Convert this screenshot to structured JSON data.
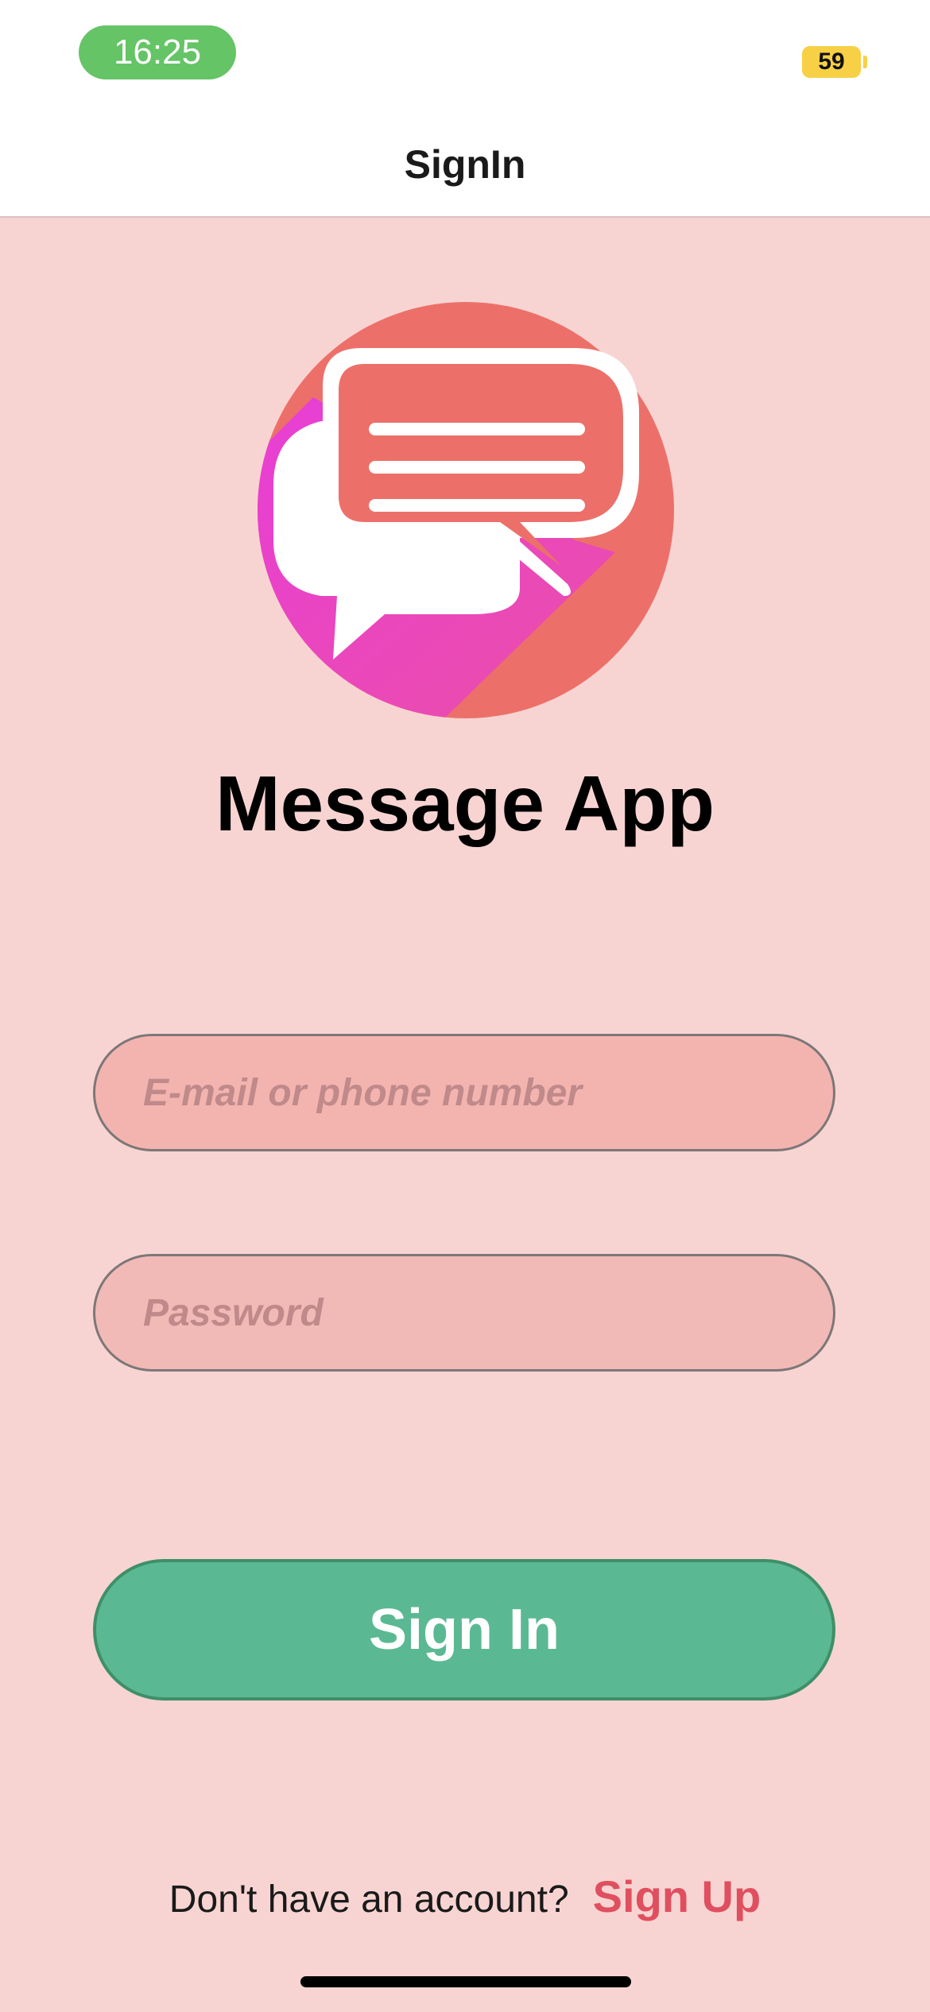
{
  "status_bar": {
    "time": "16:25",
    "battery": "59"
  },
  "nav": {
    "title": "SignIn"
  },
  "app": {
    "name": "Message App",
    "logo_icon": "chat-bubbles-icon"
  },
  "form": {
    "email_placeholder": "E-mail or phone number",
    "password_placeholder": "Password",
    "signin_label": "Sign In"
  },
  "footer": {
    "question": "Don't have an account?",
    "signup_label": "Sign Up"
  },
  "colors": {
    "background": "#f7d4d2",
    "primary_button": "#5ab993",
    "signup_link": "#e04f5f",
    "time_pill": "#65c466",
    "battery": "#f7d046"
  }
}
